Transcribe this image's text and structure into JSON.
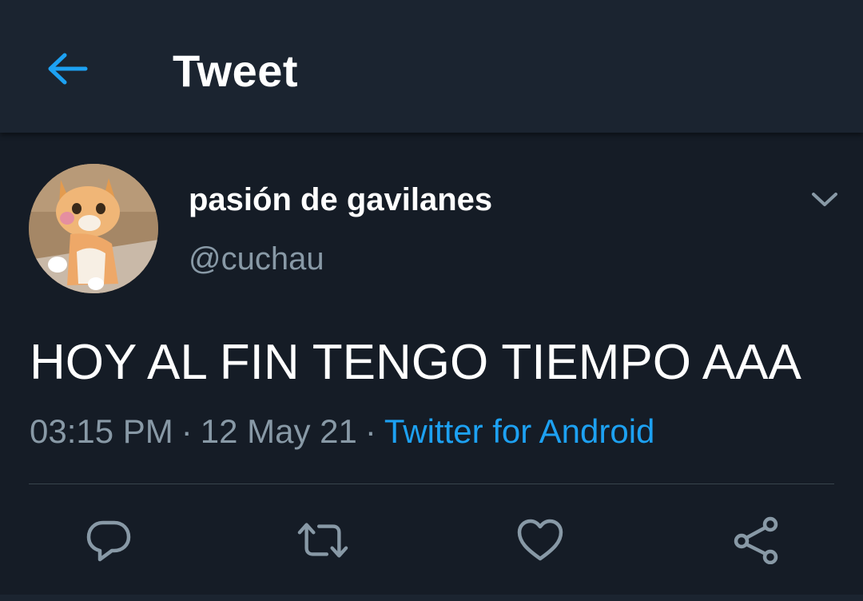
{
  "header": {
    "title": "Tweet",
    "back_icon": "arrow-left-icon"
  },
  "tweet": {
    "author": {
      "display_name": "pasión de gavilanes",
      "handle": "@cuchau",
      "avatar": "cat-photo-avatar"
    },
    "text": "HOY AL FIN TENGO TIEMPO AAA",
    "time": "03:15 PM",
    "date": "12 May 21",
    "separator": "·",
    "source": "Twitter for Android"
  },
  "actions": {
    "reply": "reply-icon",
    "retweet": "retweet-icon",
    "like": "heart-icon",
    "share": "share-icon"
  },
  "colors": {
    "background": "#151c26",
    "header_bg": "#1b2430",
    "accent": "#1da1f2",
    "secondary_text": "#8899a6",
    "icon": "#8899a6"
  }
}
